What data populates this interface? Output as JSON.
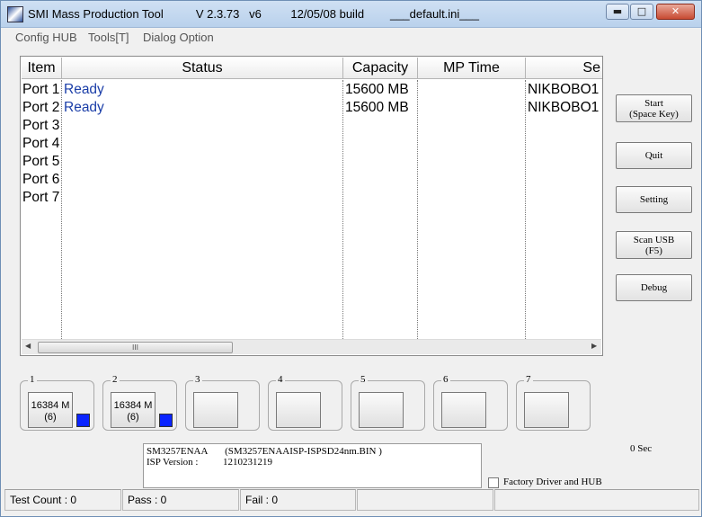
{
  "window": {
    "title": "SMI Mass Production Tool          V 2.3.73   v6         12/05/08 build        ___default.ini___",
    "min_glyph": "▬",
    "max_glyph": "□",
    "close_glyph": "✕"
  },
  "menu": [
    "Config HUB",
    "Tools[T]",
    "Dialog Option"
  ],
  "table": {
    "columns": [
      "Item",
      "Status",
      "Capacity",
      "MP Time",
      "Se"
    ],
    "rows": [
      {
        "item": "Port 1",
        "status": "Ready",
        "capacity": "15600 MB",
        "mp_time": "",
        "serial": "NIKBOBO1"
      },
      {
        "item": "Port 2",
        "status": "Ready",
        "capacity": "15600 MB",
        "mp_time": "",
        "serial": "NIKBOBO1"
      },
      {
        "item": "Port 3",
        "status": "",
        "capacity": "",
        "mp_time": "",
        "serial": ""
      },
      {
        "item": "Port 4",
        "status": "",
        "capacity": "",
        "mp_time": "",
        "serial": ""
      },
      {
        "item": "Port 5",
        "status": "",
        "capacity": "",
        "mp_time": "",
        "serial": ""
      },
      {
        "item": "Port 6",
        "status": "",
        "capacity": "",
        "mp_time": "",
        "serial": ""
      },
      {
        "item": "Port 7",
        "status": "",
        "capacity": "",
        "mp_time": "",
        "serial": ""
      }
    ],
    "scroll_thumb_glyph": "III"
  },
  "buttons": {
    "start_line1": "Start",
    "start_line2": "(Space Key)",
    "quit": "Quit",
    "setting": "Setting",
    "scan_line1": "Scan USB",
    "scan_line2": "(F5)",
    "debug": "Debug"
  },
  "ports": [
    {
      "num": "1",
      "label_line1": "16384 M",
      "label_line2": "(6)",
      "active": true
    },
    {
      "num": "2",
      "label_line1": "16384 M",
      "label_line2": "(6)",
      "active": true
    },
    {
      "num": "3",
      "label_line1": "",
      "label_line2": "",
      "active": false
    },
    {
      "num": "4",
      "label_line1": "",
      "label_line2": "",
      "active": false
    },
    {
      "num": "5",
      "label_line1": "",
      "label_line2": "",
      "active": false
    },
    {
      "num": "6",
      "label_line1": "",
      "label_line2": "",
      "active": false
    },
    {
      "num": "7",
      "label_line1": "",
      "label_line2": "",
      "active": false
    }
  ],
  "info": {
    "line1": "SM3257ENAA       (SM3257ENAAISP-ISPSD24nm.BIN )",
    "line2": "ISP Version :          1210231219"
  },
  "elapsed": "0 Sec",
  "factory_label": "Factory Driver and HUB",
  "status": {
    "test_count": "Test Count : 0",
    "pass": "Pass : 0",
    "fail": "Fail : 0"
  },
  "colors": {
    "ready_text": "#1b3ea8",
    "port_led": "#0a24ff"
  }
}
